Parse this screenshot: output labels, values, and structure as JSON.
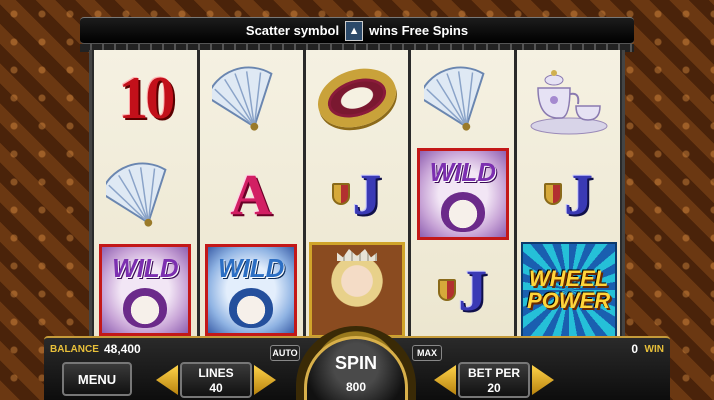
{
  "banner": {
    "text_before": "Scatter symbol",
    "scatter_icon": "wolf-scatter-icon",
    "text_after": "wins Free Spins"
  },
  "reels": [
    [
      "10",
      "fan",
      "wild-purple"
    ],
    [
      "fan",
      "A",
      "wild-blue"
    ],
    [
      "ring",
      "J",
      "queen"
    ],
    [
      "fan",
      "wild-purple",
      "J"
    ],
    [
      "teaset",
      "J",
      "wheel-power"
    ]
  ],
  "symbols": {
    "ten": "10",
    "ace": "A",
    "jack": "J",
    "wild": "WILD",
    "wheel_power_line1": "WHEEL",
    "wheel_power_line2": "POWER"
  },
  "controls": {
    "balance_label": "BALANCE",
    "balance_value": "48,400",
    "win_value": "0",
    "win_label": "WIN",
    "menu_label": "MENU",
    "lines_label": "LINES",
    "lines_value": "40",
    "auto_label": "AUTO",
    "spin_label": "SPIN",
    "spin_value": "800",
    "max_label": "MAX",
    "bet_per_label": "BET PER",
    "bet_per_value": "20"
  },
  "colors": {
    "gold": "#e8c03a",
    "ten_red": "#c2101a",
    "ace_pink": "#d21f63",
    "jack_blue": "#3a3ab5"
  }
}
